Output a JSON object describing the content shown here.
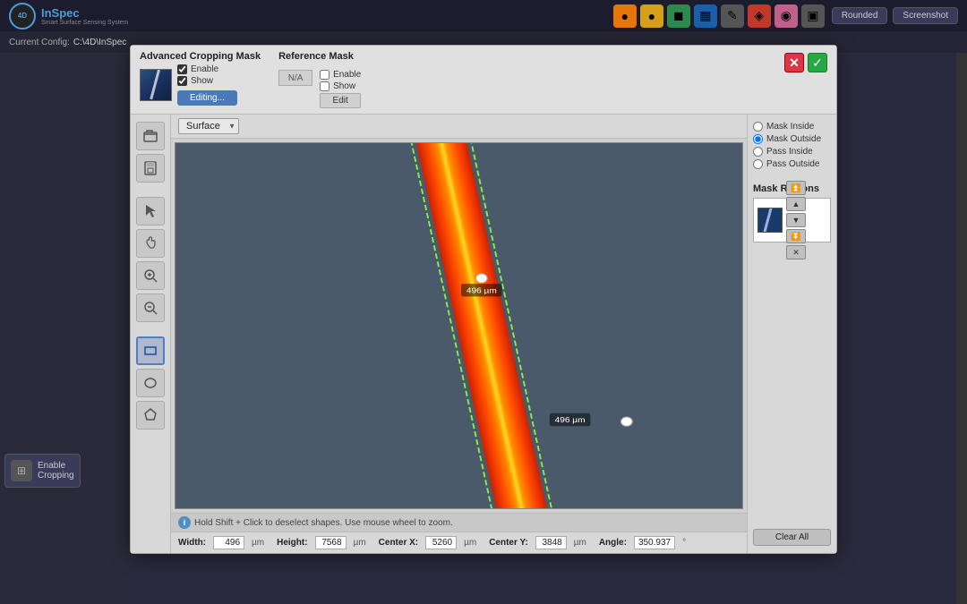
{
  "app": {
    "logo": "4D",
    "logo_sub": "InSpec",
    "config_label": "Current Config:",
    "config_path": "C:\\4D\\InSpec"
  },
  "toolbar": {
    "icons": [
      "🟠",
      "🟡",
      "🟢",
      "🔵",
      "🟣",
      "🔴",
      "🩷",
      "⬜"
    ],
    "rounded_btn": "Rounded",
    "screenshot_btn": "Screenshot"
  },
  "modal": {
    "advanced_crop_title": "Advanced Cropping Mask",
    "enable_label": "Enable",
    "show_label": "Show",
    "editing_btn": "Editing...",
    "ref_mask_title": "Reference Mask",
    "ref_enable_label": "Enable",
    "ref_show_label": "Show",
    "ref_na": "N/A",
    "edit_btn": "Edit",
    "close_x": "✕",
    "close_check": "✓",
    "surface_label": "Surface",
    "hint_text": "Hold Shift + Click to deselect shapes. Use mouse wheel to zoom.",
    "mask_inside": "Mask Inside",
    "mask_outside": "Mask Outside",
    "pass_inside": "Pass Inside",
    "pass_outside": "Pass Outside",
    "mask_regions_title": "Mask Regions",
    "clear_all_btn": "Clear All",
    "measurements": {
      "width_label": "Width:",
      "width_value": "496",
      "width_unit": "µm",
      "height_label": "Height:",
      "height_value": "7568",
      "height_unit": "µm",
      "center_x_label": "Center X:",
      "center_x_value": "5260",
      "center_x_unit": "µm",
      "center_y_label": "Center Y:",
      "center_y_value": "3848",
      "center_y_unit": "µm",
      "angle_label": "Angle:",
      "angle_value": "350.937",
      "angle_unit": "°"
    }
  },
  "left_panel": {
    "enable_cropping_label": "Enable\nCropping"
  },
  "tools": {
    "open": "📂",
    "save": "💾",
    "arrow": "↖",
    "hand": "✋",
    "zoom_in": "🔍+",
    "zoom_out": "🔍-",
    "rect": "▭",
    "circle": "○",
    "polygon": "⬡"
  },
  "region_controls": {
    "up_top": "⏫",
    "up": "▲",
    "down": "▼",
    "down_bottom": "⏬",
    "remove": "✕"
  },
  "canvas": {
    "strip_label_top": "496 µm",
    "strip_label_mid": "496 µm"
  }
}
